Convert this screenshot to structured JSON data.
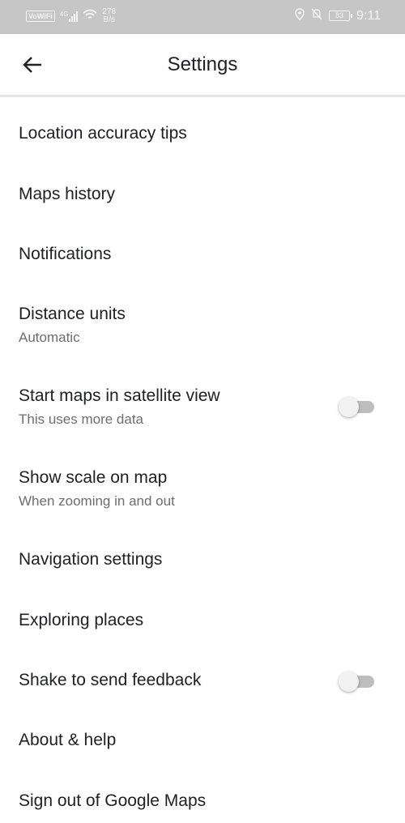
{
  "status_bar": {
    "network_badge": "VoWiFi",
    "signal_label": "4G",
    "speed_value": "278",
    "speed_unit": "B/s",
    "battery_level": "83",
    "time": "9:11"
  },
  "header": {
    "title": "Settings",
    "back_icon": "arrow-back-icon"
  },
  "settings": {
    "items": [
      {
        "label": "Location accuracy tips"
      },
      {
        "label": "Maps history"
      },
      {
        "label": "Notifications"
      },
      {
        "label": "Distance units",
        "subtitle": "Automatic"
      },
      {
        "label": "Start maps in satellite view",
        "subtitle": "This uses more data",
        "toggle": false
      },
      {
        "label": "Show scale on map",
        "subtitle": "When zooming in and out"
      },
      {
        "label": "Navigation settings"
      },
      {
        "label": "Exploring places"
      },
      {
        "label": "Shake to send feedback",
        "toggle": false
      },
      {
        "label": "About & help"
      },
      {
        "label": "Sign out of Google Maps"
      }
    ]
  },
  "colors": {
    "status_bar": "#c6c6c6",
    "text_primary": "#202124",
    "text_secondary": "#6d6d6d",
    "toggle_off_track": "#bdbdbd"
  }
}
